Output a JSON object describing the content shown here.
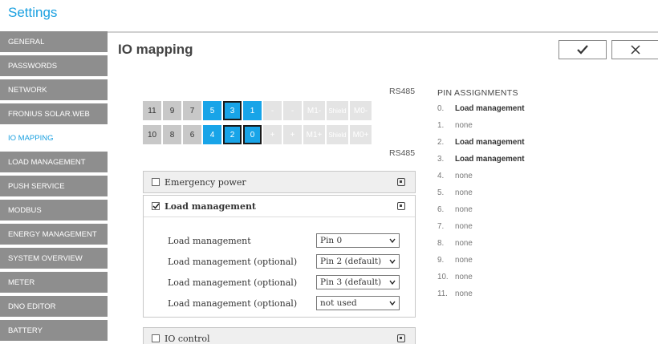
{
  "header": {
    "settings_title": "Settings",
    "cut_heading": "Settings – IO mapping"
  },
  "sidebar": {
    "items": [
      {
        "label": "GENERAL",
        "active": false
      },
      {
        "label": "PASSWORDS",
        "active": false
      },
      {
        "label": "NETWORK",
        "active": false
      },
      {
        "label": "FRONIUS SOLAR.WEB",
        "active": false
      },
      {
        "label": "IO MAPPING",
        "active": true
      },
      {
        "label": "LOAD MANAGEMENT",
        "active": false
      },
      {
        "label": "PUSH SERVICE",
        "active": false
      },
      {
        "label": "MODBUS",
        "active": false
      },
      {
        "label": "ENERGY MANAGEMENT",
        "active": false
      },
      {
        "label": "SYSTEM OVERVIEW",
        "active": false
      },
      {
        "label": "METER",
        "active": false
      },
      {
        "label": "DNO EDITOR",
        "active": false
      },
      {
        "label": "BATTERY",
        "active": false
      }
    ]
  },
  "page": {
    "title": "IO mapping",
    "confirm_icon": "checkmark-icon",
    "cancel_icon": "close-icon"
  },
  "pins": {
    "rs485_top": "RS485",
    "rs485_bottom": "RS485",
    "row_top": [
      {
        "label": "11",
        "style": "gray"
      },
      {
        "label": "9",
        "style": "gray"
      },
      {
        "label": "7",
        "style": "gray"
      },
      {
        "label": "5",
        "style": "blue"
      },
      {
        "label": "3",
        "style": "blue-selected"
      },
      {
        "label": "1",
        "style": "blue"
      },
      {
        "label": "-",
        "style": "dim"
      },
      {
        "label": "-",
        "style": "dim"
      },
      {
        "label": "M1-",
        "style": "dim"
      },
      {
        "label": "Shield",
        "style": "dim"
      },
      {
        "label": "M0-",
        "style": "dim"
      }
    ],
    "row_bottom": [
      {
        "label": "10",
        "style": "gray"
      },
      {
        "label": "8",
        "style": "gray"
      },
      {
        "label": "6",
        "style": "gray"
      },
      {
        "label": "4",
        "style": "blue"
      },
      {
        "label": "2",
        "style": "blue-selected"
      },
      {
        "label": "0",
        "style": "blue-selected"
      },
      {
        "label": "+",
        "style": "dim"
      },
      {
        "label": "+",
        "style": "dim"
      },
      {
        "label": "M1+",
        "style": "dim"
      },
      {
        "label": "Shield",
        "style": "dim"
      },
      {
        "label": "M0+",
        "style": "dim"
      }
    ]
  },
  "panels": {
    "emergency_power": {
      "label": "Emergency power",
      "checked": false
    },
    "load_management": {
      "label": "Load management",
      "checked": true
    },
    "io_control": {
      "label": "IO control",
      "checked": false
    }
  },
  "load_management_rows": [
    {
      "label": "Load management",
      "value": "Pin 0"
    },
    {
      "label": "Load management (optional)",
      "value": "Pin 2 (default)"
    },
    {
      "label": "Load management (optional)",
      "value": "Pin 3 (default)"
    },
    {
      "label": "Load management (optional)",
      "value": "not used"
    }
  ],
  "assignments": {
    "title": "PIN ASSIGNMENTS",
    "rows": [
      {
        "num": "0.",
        "value": "Load management",
        "strong": true
      },
      {
        "num": "1.",
        "value": "none",
        "strong": false
      },
      {
        "num": "2.",
        "value": "Load management",
        "strong": true
      },
      {
        "num": "3.",
        "value": "Load management",
        "strong": true
      },
      {
        "num": "4.",
        "value": "none",
        "strong": false
      },
      {
        "num": "5.",
        "value": "none",
        "strong": false
      },
      {
        "num": "6.",
        "value": "none",
        "strong": false
      },
      {
        "num": "7.",
        "value": "none",
        "strong": false
      },
      {
        "num": "8.",
        "value": "none",
        "strong": false
      },
      {
        "num": "9.",
        "value": "none",
        "strong": false
      },
      {
        "num": "10.",
        "value": "none",
        "strong": false
      },
      {
        "num": "11.",
        "value": "none",
        "strong": false
      }
    ]
  },
  "colors": {
    "accent": "#1aa0e0",
    "pin_blue": "#18a4e8",
    "sidebar_gray": "#8e8e8e"
  }
}
